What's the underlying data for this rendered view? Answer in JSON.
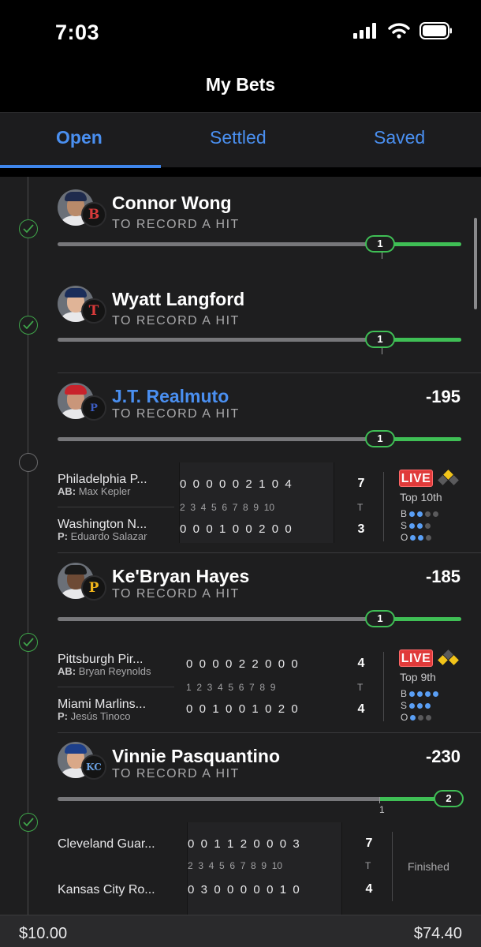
{
  "status_bar": {
    "time": "7:03"
  },
  "header": {
    "title": "My Bets"
  },
  "tabs": [
    {
      "label": "Open",
      "active": true
    },
    {
      "label": "Settled",
      "active": false
    },
    {
      "label": "Saved",
      "active": false
    }
  ],
  "legs": [
    {
      "player": "Connor Wong",
      "market": "TO RECORD A HIT",
      "team_logo": "B",
      "progress": "1",
      "status": "won",
      "odds": ""
    },
    {
      "player": "Wyatt Langford",
      "market": "TO RECORD A HIT",
      "team_logo": "T",
      "progress": "1",
      "status": "won",
      "odds": ""
    },
    {
      "player": "J.T. Realmuto",
      "market": "TO RECORD A HIT",
      "team_logo": "P",
      "progress": "1",
      "status": "pending",
      "odds": "-195",
      "game": {
        "away_team": "Philadelphia P...",
        "away_sub_label": "AB:",
        "away_sub_name": "Max Kepler",
        "home_team": "Washington N...",
        "home_sub_label": "P:",
        "home_sub_name": "Eduardo Salazar",
        "away_line": "0  0  0  0  0  2  1  0  4",
        "innings": "2  3  4  5  6  7  8  9  10",
        "home_line": "0  0  0  1  0  0  2  0  0",
        "away_total": "7",
        "home_total": "3",
        "total_label": "T",
        "live_label": "LIVE",
        "inning_label": "Top 10th",
        "b_label": "B",
        "s_label": "S",
        "o_label": "O",
        "balls": 1,
        "strikes": 2,
        "outs": 2
      }
    },
    {
      "player": "Ke'Bryan Hayes",
      "market": "TO RECORD A HIT",
      "team_logo": "P",
      "progress": "1",
      "status": "won",
      "odds": "-185",
      "game": {
        "away_team": "Pittsburgh Pir...",
        "away_sub_label": "AB:",
        "away_sub_name": "Bryan Reynolds",
        "home_team": "Miami Marlins...",
        "home_sub_label": "P:",
        "home_sub_name": "Jesús Tinoco",
        "away_line": "0  0  0  0  2  2  0  0  0",
        "innings": "1  2  3  4  5  6  7  8  9",
        "home_line": "0  0  1  0  0  1  0  2  0",
        "away_total": "4",
        "home_total": "4",
        "total_label": "T",
        "live_label": "LIVE",
        "inning_label": "Top 9th",
        "b_label": "B",
        "s_label": "S",
        "o_label": "O",
        "balls": 4,
        "strikes": 3,
        "outs": 1
      }
    },
    {
      "player": "Vinnie Pasquantino",
      "market": "TO RECORD A HIT",
      "team_logo": "KC",
      "progress": "2",
      "threshold": "1",
      "status": "won",
      "odds": "-230",
      "game": {
        "away_team": "Cleveland Guar...",
        "home_team": "Kansas City Ro...",
        "away_line": "0  0  1  1  2  0  0  0  3",
        "innings": "2  3  4  5  6  7  8  9  10",
        "home_line": "0  3  0  0  0  0  0  1  0",
        "away_total": "7",
        "home_total": "4",
        "total_label": "T",
        "final_label": "Finished"
      }
    }
  ],
  "footer": {
    "stake": "$10.00",
    "payout": "$74.40"
  },
  "colors": {
    "accent": "#4a8ff0",
    "success": "#3fbf55",
    "live": "#e03a3a",
    "diamond": "#f2c41a"
  }
}
